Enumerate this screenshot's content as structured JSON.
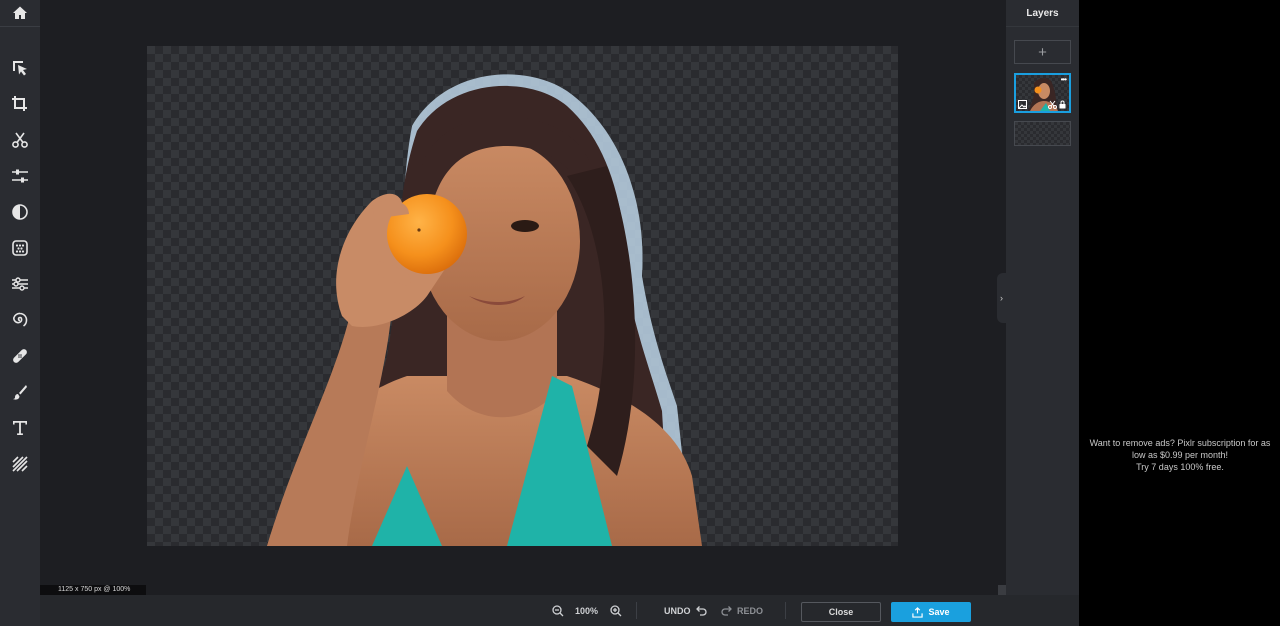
{
  "toolbar": {
    "home_icon": "home-icon",
    "tools": [
      {
        "name": "arrange",
        "icon": "select-arrow-icon"
      },
      {
        "name": "crop",
        "icon": "crop-icon"
      },
      {
        "name": "cutout",
        "icon": "scissors-icon"
      },
      {
        "name": "adjust",
        "icon": "sliders-icon"
      },
      {
        "name": "filter",
        "icon": "contrast-icon"
      },
      {
        "name": "effect",
        "icon": "dots-grid-icon"
      },
      {
        "name": "liquify",
        "icon": "liquify-icon"
      },
      {
        "name": "spiral",
        "icon": "swirl-icon"
      },
      {
        "name": "retouch",
        "icon": "bandage-icon"
      },
      {
        "name": "draw",
        "icon": "brush-icon"
      },
      {
        "name": "text",
        "icon": "text-icon"
      },
      {
        "name": "pattern",
        "icon": "hatch-icon"
      }
    ]
  },
  "canvas": {
    "dimension_label": "1125 x 750 px @ 100%"
  },
  "layers": {
    "title": "Layers",
    "add_label": "+",
    "selected_layer_more": "•••"
  },
  "bottombar": {
    "zoom_value": "100%",
    "undo_label": "UNDO",
    "redo_label": "REDO",
    "close_label": "Close",
    "save_label": "Save"
  },
  "ad": {
    "line1": "Want to remove ads? Pixlr subscription for as low as $0.99 per month!",
    "line2": "Try 7 days 100% free."
  },
  "colors": {
    "accent": "#1aa0de",
    "panel": "#2a2c31",
    "workspace": "#1d1e22"
  }
}
